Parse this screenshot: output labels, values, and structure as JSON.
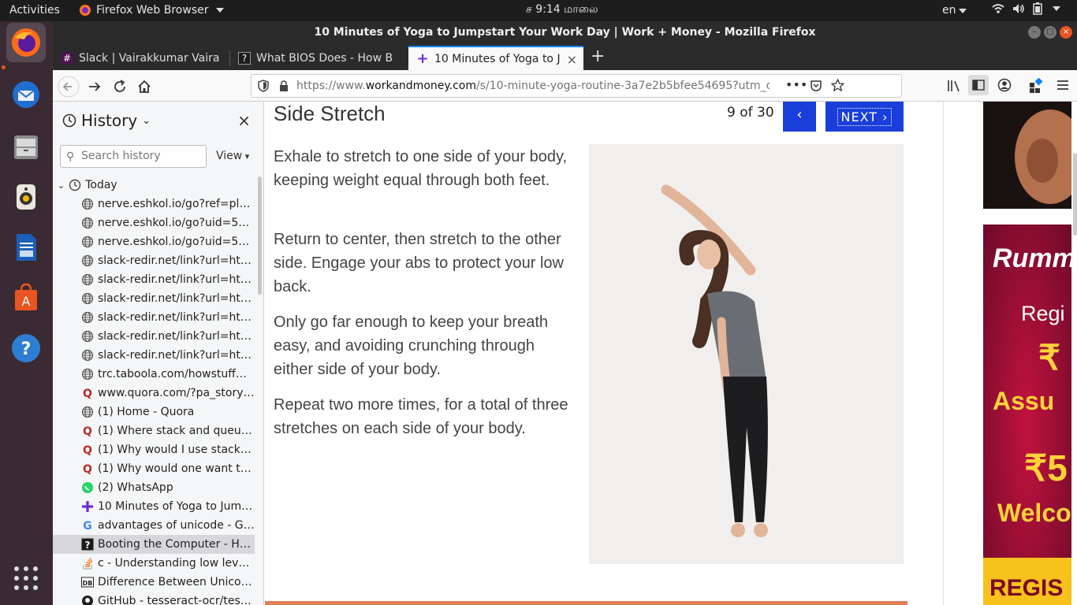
{
  "topbar": {
    "activities": "Activities",
    "app_name": "Firefox Web Browser",
    "clock": "ச 9:14 மாலை",
    "lang": "en"
  },
  "window": {
    "title": "10 Minutes of Yoga to Jumpstart Your Work Day | Work + Money - Mozilla Firefox"
  },
  "tabs": [
    {
      "label": "Slack | Vairakkumar Vaira",
      "favicon": "slack-icon"
    },
    {
      "label": "What BIOS Does - How B",
      "favicon": "howstuffworks-icon"
    },
    {
      "label": "10 Minutes of Yoga to Ju",
      "favicon": "plus-icon",
      "active": true
    }
  ],
  "nav": {
    "url_prefix": "https://www.",
    "url_domain": "workandmoney.com",
    "url_rest": "/s/10-minute-yoga-routine-3a7e2b5bfee54695?utm_c"
  },
  "sidebar": {
    "title": "History",
    "search_placeholder": "Search history",
    "view_label": "View",
    "group_label": "Today",
    "items": [
      {
        "label": "nerve.eshkol.io/go?ref=pl&h...",
        "icon": "globe-icon"
      },
      {
        "label": "nerve.eshkol.io/go?uid=5e1...",
        "icon": "globe-icon"
      },
      {
        "label": "nerve.eshkol.io/go?uid=5e1...",
        "icon": "globe-icon"
      },
      {
        "label": "slack-redir.net/link?url=http...",
        "icon": "globe-icon"
      },
      {
        "label": "slack-redir.net/link?url=http...",
        "icon": "globe-icon"
      },
      {
        "label": "slack-redir.net/link?url=http...",
        "icon": "globe-icon"
      },
      {
        "label": "slack-redir.net/link?url=http...",
        "icon": "globe-icon"
      },
      {
        "label": "slack-redir.net/link?url=http...",
        "icon": "globe-icon"
      },
      {
        "label": "slack-redir.net/link?url=http...",
        "icon": "globe-icon"
      },
      {
        "label": "trc.taboola.com/howstuffwo...",
        "icon": "globe-icon"
      },
      {
        "label": "www.quora.com/?pa_story=...",
        "icon": "quora-icon"
      },
      {
        "label": "(1) Home - Quora",
        "icon": "globe-icon"
      },
      {
        "label": "(1) Where stack and queue u...",
        "icon": "quora-icon"
      },
      {
        "label": "(1) Why would I use stack ins...",
        "icon": "quora-icon"
      },
      {
        "label": "(1) Why would one want to u...",
        "icon": "quora-icon"
      },
      {
        "label": "(2) WhatsApp",
        "icon": "whatsapp-icon"
      },
      {
        "label": "10 Minutes of Yoga to Jump...",
        "icon": "plus-icon"
      },
      {
        "label": "advantages of unicode - Goo...",
        "icon": "google-icon"
      },
      {
        "label": "Booting the Computer - How...",
        "icon": "howstuffworks-icon",
        "selected": true
      },
      {
        "label": "c - Understanding low level f...",
        "icon": "stackoverflow-icon"
      },
      {
        "label": "Difference Between Unicod...",
        "icon": "db-icon"
      },
      {
        "label": "GitHub - tesseract-ocr/tessd...",
        "icon": "github-icon"
      }
    ]
  },
  "article": {
    "title": "Side Stretch",
    "counter": "9 of 30",
    "prev": "‹",
    "next": "NEXT ›",
    "paragraphs": [
      "Exhale to stretch to one side of your body, keeping weight equal through both feet.",
      "Return to center, then stretch to the other side. Engage your abs to protect your low back.",
      "Only go far enough to keep your breath easy, and avoiding crunching through either side of your body.",
      "Repeat two more times, for a total of three stretches on each side of your body."
    ]
  },
  "ads": {
    "brand": "Rumm",
    "line1": "Regi",
    "rupee1": "₹",
    "line2": "Assu",
    "rupee2": "₹5",
    "line3": "Welco",
    "cta": "REGIS"
  },
  "colors": {
    "accent": "#1a3edb",
    "orange": "#e07d56",
    "ubuntu_orange": "#e95420"
  }
}
